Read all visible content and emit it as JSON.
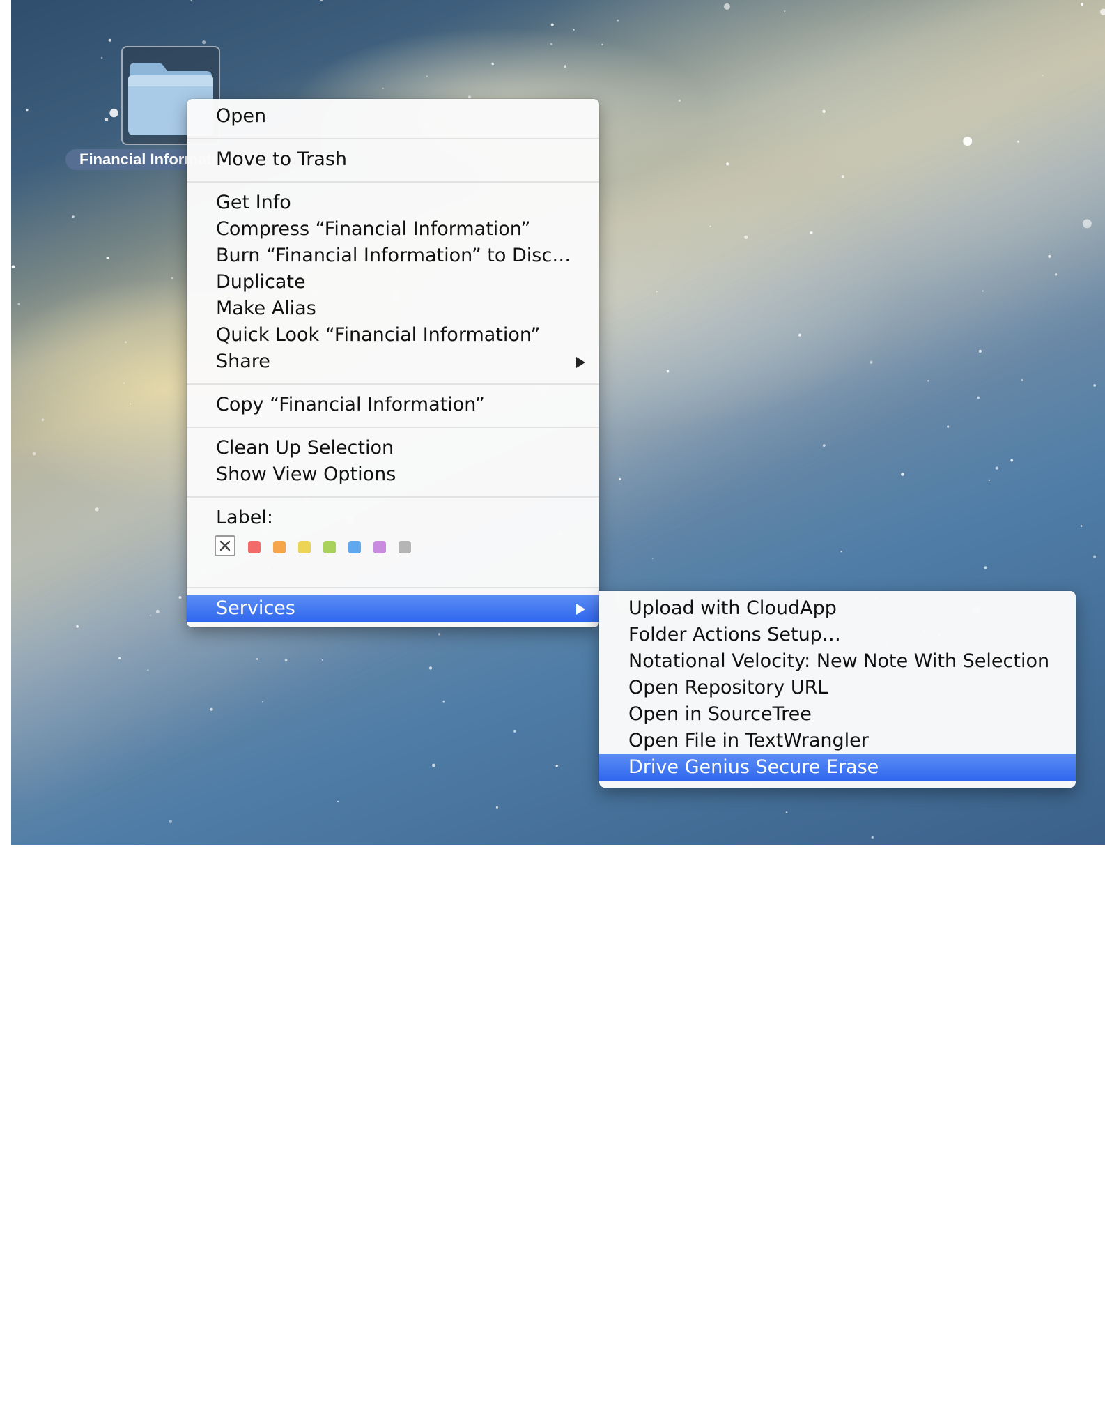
{
  "desktop": {
    "folder_name": "Financial Information"
  },
  "context_menu": {
    "groups": [
      [
        "Open"
      ],
      [
        "Move to Trash"
      ],
      [
        "Get Info",
        "Compress “Financial Information”",
        "Burn “Financial Information” to Disc…",
        "Duplicate",
        "Make Alias",
        "Quick Look “Financial Information”",
        "Share"
      ],
      [
        "Copy “Financial Information”"
      ],
      [
        "Clean Up Selection",
        "Show View Options"
      ]
    ],
    "label_title": "Label:",
    "label_colors": [
      "#f26a6a",
      "#f5a64a",
      "#ecd456",
      "#a8d25a",
      "#5fa8ee",
      "#c98be0",
      "#b5b5b5"
    ],
    "services_label": "Services"
  },
  "services_submenu": {
    "items": [
      "Upload with CloudApp",
      "Folder Actions Setup…",
      "Notational Velocity: New Note With Selection",
      "Open Repository URL",
      "Open in SourceTree",
      "Open File in TextWrangler",
      "Drive Genius Secure Erase"
    ],
    "highlighted_index": 6
  },
  "colors": {
    "highlight": "#3067ee"
  }
}
